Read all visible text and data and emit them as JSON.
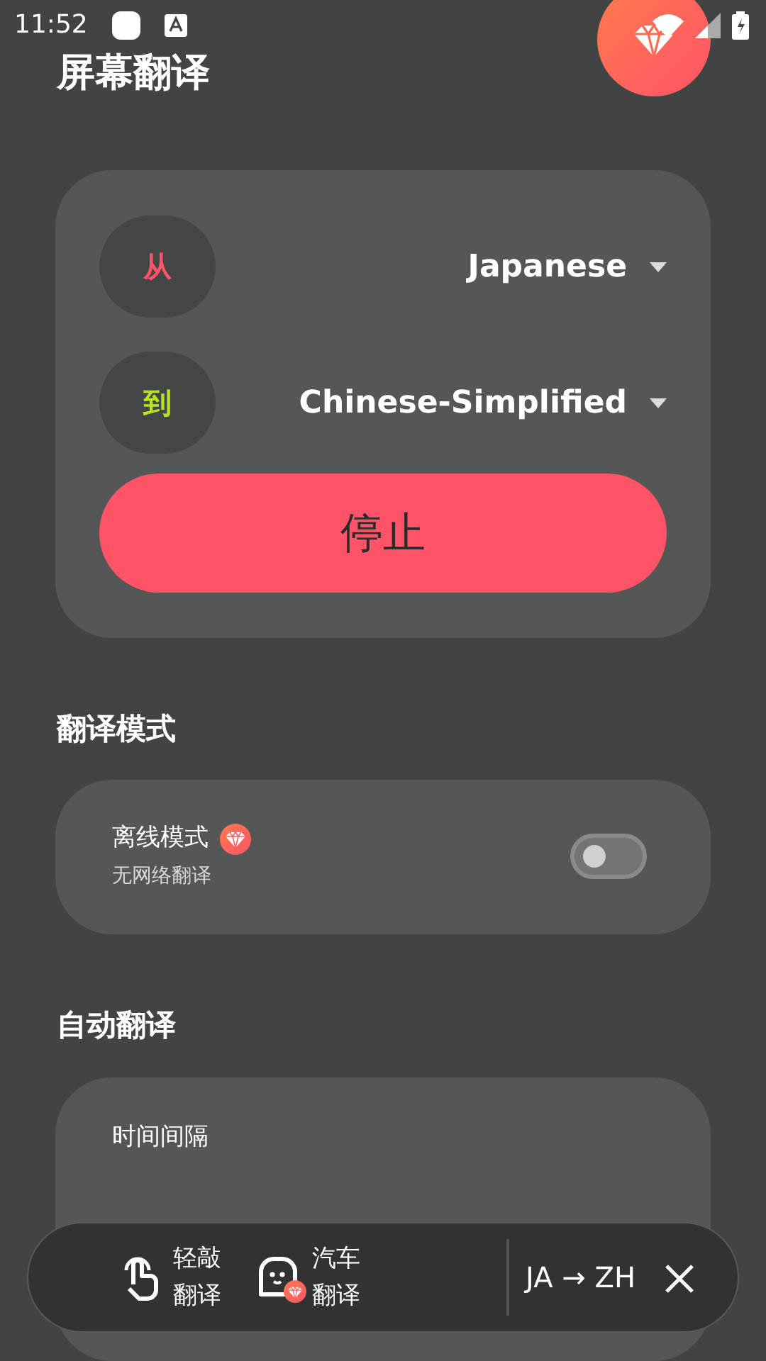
{
  "status_bar": {
    "time": "11:52"
  },
  "header": {
    "title": "屏幕翻译"
  },
  "language_card": {
    "rows": [
      {
        "label": "从",
        "color": "#ff5468",
        "language": "Japanese"
      },
      {
        "label": "到",
        "color": "#b5e61d",
        "language": "Chinese-Simplified"
      }
    ],
    "action_button": "停止"
  },
  "sections": [
    {
      "heading": "翻译模式",
      "kind": "toggle",
      "title": "离线模式",
      "premium": true,
      "subtitle": "无网络翻译",
      "on": false
    },
    {
      "heading": "自动翻译",
      "kind": "partial",
      "title": "时间间隔"
    }
  ],
  "bottom_bar": {
    "actions": [
      {
        "kind": "tap",
        "line1": "轻敲",
        "line2": "翻译",
        "premium": false
      },
      {
        "kind": "car",
        "line1": "汽车",
        "line2": "翻译",
        "premium": true
      }
    ],
    "language_pair": "JA → ZH"
  }
}
